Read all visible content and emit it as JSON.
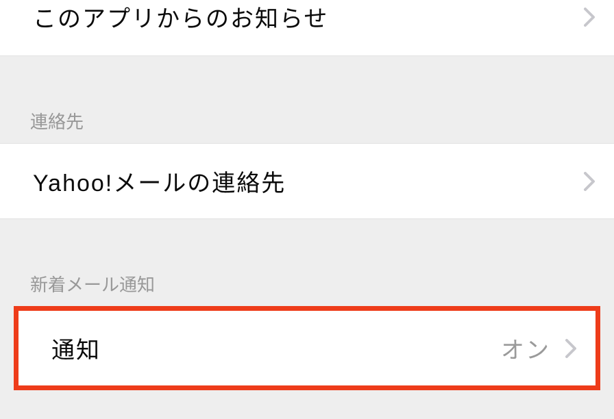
{
  "rows": {
    "app_notice": {
      "label": "このアプリからのお知らせ"
    }
  },
  "sections": {
    "contacts": {
      "header": "連絡先",
      "item": {
        "label": "Yahoo!メールの連絡先"
      }
    },
    "newmail": {
      "header": "新着メール通知",
      "item": {
        "label": "通知",
        "value": "オン"
      }
    }
  }
}
